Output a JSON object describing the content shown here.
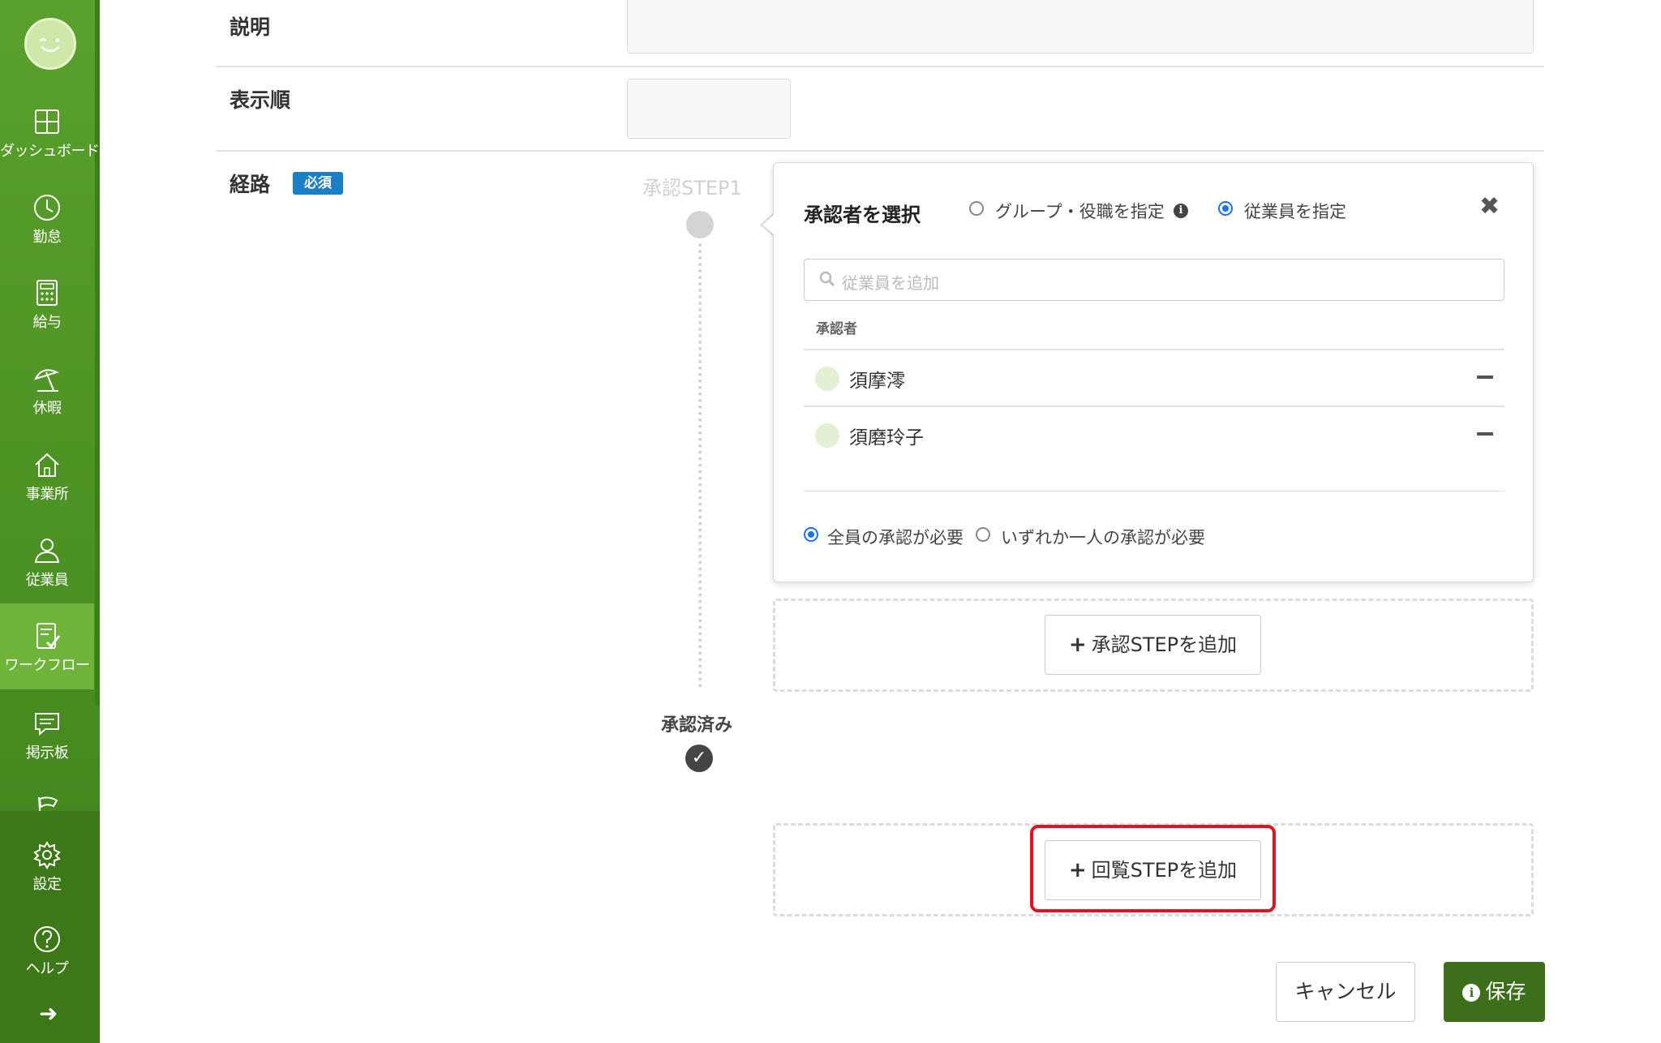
{
  "sidebar": {
    "items": [
      {
        "label": "ダッシュボード",
        "icon": "dashboard-icon"
      },
      {
        "label": "勤怠",
        "icon": "clock-icon"
      },
      {
        "label": "給与",
        "icon": "calculator-icon"
      },
      {
        "label": "休暇",
        "icon": "beach-umbrella-icon"
      },
      {
        "label": "事業所",
        "icon": "home-icon"
      },
      {
        "label": "従業員",
        "icon": "person-icon"
      },
      {
        "label": "ワークフロー",
        "icon": "workflow-icon",
        "active": true
      },
      {
        "label": "掲示板",
        "icon": "chat-icon"
      },
      {
        "label": "",
        "icon": "flag-icon"
      },
      {
        "label": "設定",
        "icon": "gear-icon"
      },
      {
        "label": "ヘルプ",
        "icon": "help-icon"
      }
    ],
    "colors": {
      "bg": "#4a8f22",
      "active": "#6fb43a",
      "bottom": "#3c7818"
    }
  },
  "form": {
    "description_label": "説明",
    "display_order_label": "表示順",
    "route_label": "経路",
    "required_badge": "必須"
  },
  "timeline": {
    "step1_label": "承認STEP1",
    "approved_label": "承認済み"
  },
  "popover": {
    "title": "承認者を選択",
    "option_group_role": "グループ・役職を指定",
    "option_employee": "従業員を指定",
    "selected_option": "従業員を指定",
    "search_placeholder": "従業員を追加",
    "approvers_header": "承認者",
    "approvers": [
      "須摩澪",
      "須磨玲子"
    ],
    "all_required": "全員の承認が必要",
    "any_one_required": "いずれか一人の承認が必要",
    "selected_condition": "全員の承認が必要"
  },
  "buttons": {
    "add_approval_step": "承認STEPを追加",
    "add_circulation_step": "回覧STEPを追加",
    "cancel": "キャンセル",
    "save": "保存"
  },
  "colors": {
    "primary_green": "#3d6f1a",
    "badge_blue": "#1a7fc4",
    "radio_blue": "#1a73e8",
    "highlight_red": "#e0141c"
  }
}
